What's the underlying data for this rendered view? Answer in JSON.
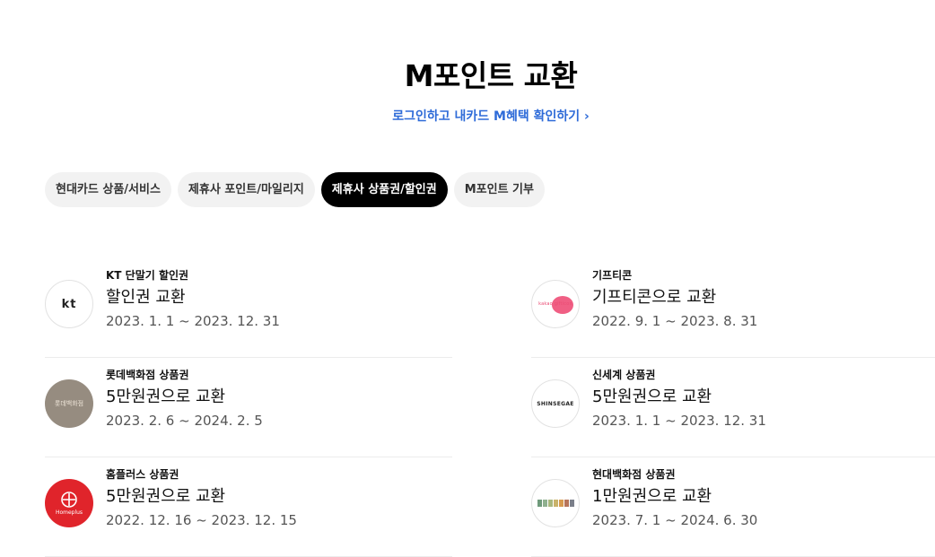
{
  "page": {
    "title": "M포인트 교환",
    "login_link": "로그인하고 내카드 M혜택 확인하기 ›"
  },
  "tabs": [
    {
      "label": "현대카드 상품/서비스",
      "active": false
    },
    {
      "label": "제휴사 포인트/마일리지",
      "active": false
    },
    {
      "label": "제휴사 상품권/할인권",
      "active": true
    },
    {
      "label": "M포인트 기부",
      "active": false
    }
  ],
  "items_left": [
    {
      "category": "KT 단말기 할인권",
      "title": "할인권 교환",
      "period": "2023. 1. 1 ~ 2023. 12. 31",
      "logo_text": "kt"
    },
    {
      "category": "롯데백화점 상품권",
      "title": "5만원권으로 교환",
      "period": "2023. 2. 6 ~ 2024. 2. 5",
      "logo_text": "롯데백화점"
    },
    {
      "category": "홈플러스 상품권",
      "title": "5만원권으로 교환",
      "period": "2022. 12. 16 ~ 2023. 12. 15",
      "logo_text": "Homeplus"
    }
  ],
  "items_right": [
    {
      "category": "기프티콘",
      "title": "기프티콘으로 교환",
      "period": "2022. 9. 1 ~ 2023. 8. 31",
      "logo_text": "kakao gifticon"
    },
    {
      "category": "신세계 상품권",
      "title": "5만원권으로 교환",
      "period": "2023. 1. 1 ~ 2023. 12. 31",
      "logo_text": "SHINSEGAE"
    },
    {
      "category": "현대백화점 상품권",
      "title": "1만원권으로 교환",
      "period": "2023. 7. 1 ~ 2024. 6. 30",
      "logo_text": ""
    }
  ],
  "colors": {
    "link": "#2e6bd8",
    "tab_active_bg": "#000000",
    "tab_bg": "#f2f2f2",
    "homeplus_red": "#e0242b",
    "lotte_taupe": "#968c80",
    "gifticon_pink": "#f05f84"
  }
}
